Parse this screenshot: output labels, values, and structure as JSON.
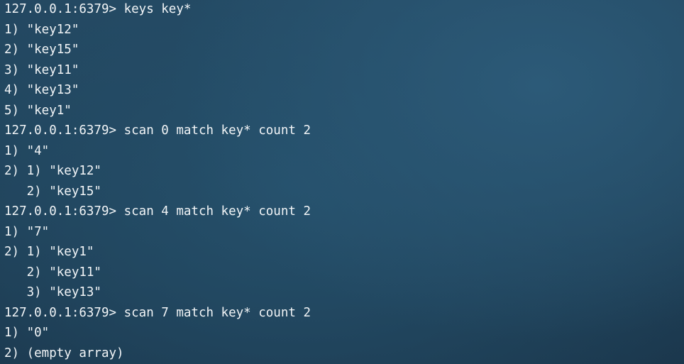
{
  "terminal": {
    "lines": [
      {
        "kind": "command",
        "prompt": "127.0.0.1:6379>",
        "text": " keys key*"
      },
      {
        "kind": "output",
        "text": "1) \"key12\""
      },
      {
        "kind": "output",
        "text": "2) \"key15\""
      },
      {
        "kind": "output",
        "text": "3) \"key11\""
      },
      {
        "kind": "output",
        "text": "4) \"key13\""
      },
      {
        "kind": "output",
        "text": "5) \"key1\""
      },
      {
        "kind": "command",
        "prompt": "127.0.0.1:6379>",
        "text": " scan 0 match key* count 2"
      },
      {
        "kind": "output",
        "text": "1) \"4\""
      },
      {
        "kind": "output",
        "text": "2) 1) \"key12\""
      },
      {
        "kind": "output",
        "text": "   2) \"key15\""
      },
      {
        "kind": "command",
        "prompt": "127.0.0.1:6379>",
        "text": " scan 4 match key* count 2"
      },
      {
        "kind": "output",
        "text": "1) \"7\""
      },
      {
        "kind": "output",
        "text": "2) 1) \"key1\""
      },
      {
        "kind": "output",
        "text": "   2) \"key11\""
      },
      {
        "kind": "output",
        "text": "   3) \"key13\""
      },
      {
        "kind": "command",
        "prompt": "127.0.0.1:6379>",
        "text": " scan 7 match key* count 2"
      },
      {
        "kind": "output",
        "text": "1) \"0\""
      },
      {
        "kind": "output",
        "text": "2) (empty array)"
      }
    ]
  }
}
